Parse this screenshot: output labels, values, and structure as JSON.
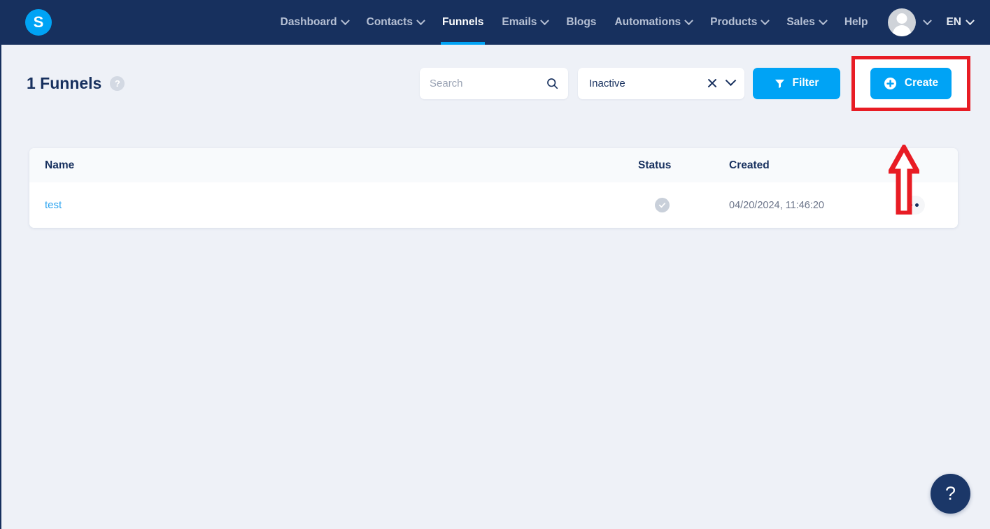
{
  "brand": {
    "logo_letter": "S",
    "logo_color": "#00a3f5",
    "navbar_color": "#17305e",
    "accent_color": "#00a3f5"
  },
  "navbar": {
    "items": [
      {
        "label": "Dashboard",
        "has_caret": true,
        "active": false
      },
      {
        "label": "Contacts",
        "has_caret": true,
        "active": false
      },
      {
        "label": "Funnels",
        "has_caret": false,
        "active": true
      },
      {
        "label": "Emails",
        "has_caret": true,
        "active": false
      },
      {
        "label": "Blogs",
        "has_caret": false,
        "active": false
      },
      {
        "label": "Automations",
        "has_caret": true,
        "active": false
      },
      {
        "label": "Products",
        "has_caret": true,
        "active": false
      },
      {
        "label": "Sales",
        "has_caret": true,
        "active": false
      },
      {
        "label": "Help",
        "has_caret": false,
        "active": false
      }
    ],
    "language": "EN"
  },
  "toolbar": {
    "title": "1 Funnels",
    "help_badge": "?",
    "search": {
      "value": "",
      "placeholder": "Search"
    },
    "status_filter": {
      "selected": "Inactive"
    },
    "filter_label": "Filter",
    "create_label": "Create"
  },
  "table": {
    "columns": [
      "Name",
      "Status",
      "Created"
    ],
    "rows": [
      {
        "name": "test",
        "status": "active-check",
        "created": "04/20/2024, 11:46:20",
        "actions": "•••"
      }
    ]
  },
  "annotation": {
    "highlight_color": "#e81c24",
    "target": "create-button"
  },
  "fab": {
    "label": "?"
  }
}
